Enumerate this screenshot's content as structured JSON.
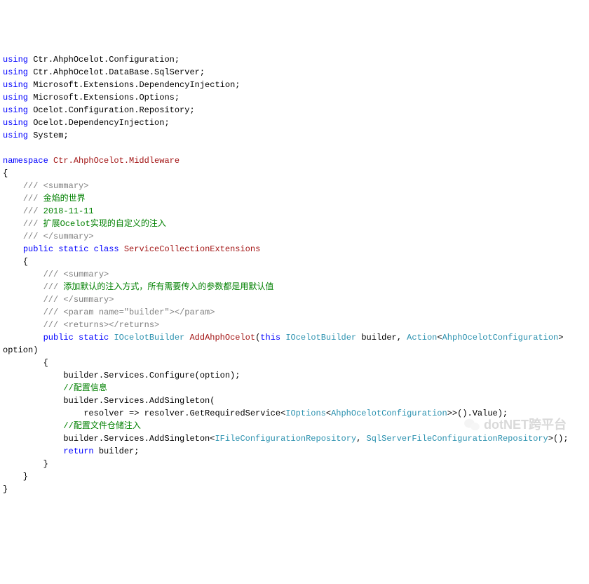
{
  "code": {
    "usings": [
      "Ctr.AhphOcelot.Configuration",
      "Ctr.AhphOcelot.DataBase.SqlServer",
      "Microsoft.Extensions.DependencyInjection",
      "Microsoft.Extensions.Options",
      "Ocelot.Configuration.Repository",
      "Ocelot.DependencyInjection",
      "System"
    ],
    "namespace": "Ctr.AhphOcelot.Middleware",
    "class_comments": {
      "open": "/// <summary>",
      "l1": "/// 金焰的世界",
      "l2": "/// 2018-11-11",
      "l3": "/// 扩展Ocelot实现的自定义的注入",
      "close": "/// </summary>"
    },
    "class_decl": {
      "kw": "public static class",
      "name": "ServiceCollectionExtensions"
    },
    "method_comments": {
      "open": "/// <summary>",
      "l1": "/// 添加默认的注入方式，所有需要传入的参数都是用默认值",
      "close": "/// </summary>",
      "param": "/// <param name=\"builder\"></param>",
      "returns": "/// <returns></returns>"
    },
    "method": {
      "kw1": "public static",
      "ret": "IOcelotBuilder",
      "name": "AddAhphOcelot",
      "th": "this",
      "arg1t": "IOcelotBuilder",
      "arg1": "builder",
      "arg2t": "Action",
      "arg2g": "AhphOcelotConfiguration",
      "arg2": "option"
    },
    "body": {
      "l1": "builder.Services.Configure(option);",
      "c1": "//配置信息",
      "l2": "builder.Services.AddSingleton(",
      "l3a": "resolver => resolver.GetRequiredService<",
      "l3t1": "IOptions",
      "l3t2": "AhphOcelotConfiguration",
      "l3b": ">>().Value);",
      "c2": "//配置文件仓储注入",
      "l4a": "builder.Services.AddSingleton<",
      "l4t1": "IFileConfigurationRepository",
      "l4t2": "SqlServerFileConfigurationRepository",
      "l4b": ">();",
      "ret": "return",
      "retv": "builder;"
    }
  },
  "watermark": "dotNET跨平台"
}
